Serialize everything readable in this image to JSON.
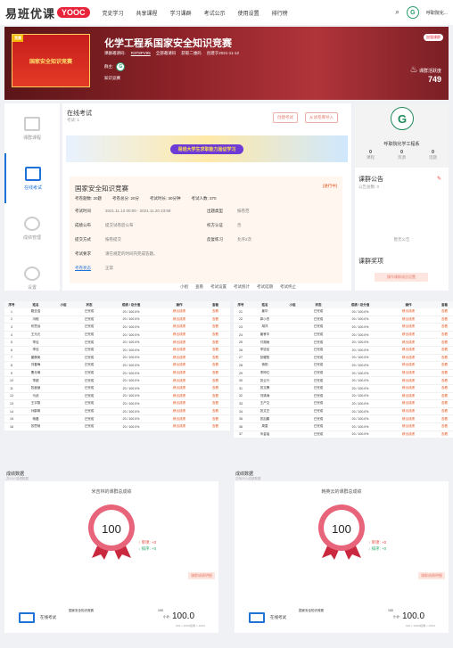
{
  "nav": {
    "logo": "易班优课",
    "badge": "YOOC",
    "links": [
      "党史学习",
      "共享课程",
      "学习课群",
      "考试公示",
      "使用设置",
      "排行榜"
    ],
    "user": "呼职院化..."
  },
  "banner": {
    "cover_text": "国家安全知识竞赛",
    "cover_tag": "竞赛",
    "title": "化学工程系国家安全知识竞赛",
    "code_label": "课群邀请码:",
    "code": "R3T8PV95",
    "meta2": "全部邀请码",
    "meta3": "获取二维码",
    "created": "创建于2021-11-12",
    "teacher_label": "群主:",
    "course_label": "知识竞赛",
    "badge": "加强课群",
    "activity_label": "课群活跃度",
    "activity": "749"
  },
  "side": [
    {
      "label": "课群课程"
    },
    {
      "label": "在线考试"
    },
    {
      "label": "成绩管理"
    },
    {
      "label": "设置"
    }
  ],
  "main": {
    "title": "在线考试",
    "count": "考试: 1",
    "btn_create": "创建考试",
    "btn_import": "从试卷库导入",
    "banner_text": "易班大学生求职能力验证学习",
    "exam": {
      "title": "国家安全知识竞赛",
      "status": "[进行中]",
      "q_count": "考卷题数: 20题",
      "total": "考卷总分: 20分",
      "duration": "考试时长: 30分钟",
      "people": "考试人数: 370",
      "rows": [
        [
          "考试时间",
          "2021.11.13 00:00 - 2021.11.20 23:59",
          "出题类型",
          "按卷范"
        ],
        [
          "成绩公布",
          "提交试卷后公布",
          "校方认证",
          "否"
        ],
        [
          "提交方式",
          "按卷提交",
          "反复练习",
          "允许2次"
        ],
        [
          "考试要求",
          "请在规定的时间内完成答题。",
          "",
          ""
        ],
        [
          "考卷状态",
          "正常",
          "",
          ""
        ]
      ]
    },
    "foot": [
      "小组",
      "查看",
      "考试设置",
      "考试统计",
      "考试延期",
      "考试终止"
    ]
  },
  "right": {
    "name": "呼职院化学工程系",
    "stats": [
      [
        "0",
        "课程"
      ],
      [
        "0",
        "资源"
      ],
      [
        "0",
        "话题"
      ]
    ],
    "notice_title": "课群公告",
    "notice_count": "公告总数: 0",
    "notice_none": "暂无公告",
    "reward_title": "课群奖项",
    "reward_btn": "操作课群成员设置"
  },
  "table_left": {
    "headers": [
      "序号",
      "姓名",
      "小组",
      "状态",
      "成绩 / 总分值",
      "操作",
      "查看"
    ],
    "rows": [
      [
        "1",
        "戴亚浩",
        "",
        "已完成",
        "20 / 100.0%",
        "移出成绩",
        "查看"
      ],
      [
        "2",
        "冯程",
        "",
        "已完成",
        "20 / 100.0%",
        "移出成绩",
        "查看"
      ],
      [
        "3",
        "布思远",
        "",
        "已完成",
        "20 / 100.0%",
        "移出成绩",
        "查看"
      ],
      [
        "4",
        "王元元",
        "",
        "已完成",
        "20 / 100.0%",
        "移出成绩",
        "查看"
      ],
      [
        "5",
        "李佳",
        "",
        "已完成",
        "20 / 100.0%",
        "移出成绩",
        "查看"
      ],
      [
        "6",
        "李佳",
        "",
        "已完成",
        "20 / 100.0%",
        "移出成绩",
        "查看"
      ],
      [
        "7",
        "董静美",
        "",
        "已完成",
        "20 / 100.0%",
        "移出成绩",
        "查看"
      ],
      [
        "8",
        "刘春梅",
        "",
        "已完成",
        "20 / 100.0%",
        "移出成绩",
        "查看"
      ],
      [
        "9",
        "曹月琳",
        "",
        "已完成",
        "20 / 100.0%",
        "移出成绩",
        "查看"
      ],
      [
        "10",
        "李超",
        "",
        "已完成",
        "20 / 100.0%",
        "移出成绩",
        "查看"
      ],
      [
        "11",
        "张鑫营",
        "",
        "已完成",
        "20 / 100.0%",
        "移出成绩",
        "查看"
      ],
      [
        "12",
        "马武",
        "",
        "已完成",
        "20 / 100.0%",
        "移出成绩",
        "查看"
      ],
      [
        "13",
        "王宇翔",
        "",
        "已完成",
        "20 / 100.0%",
        "移出成绩",
        "查看"
      ],
      [
        "14",
        "孙鹤明",
        "",
        "已完成",
        "20 / 100.0%",
        "移出成绩",
        "查看"
      ],
      [
        "15",
        "杨磊",
        "",
        "已完成",
        "20 / 100.0%",
        "移出成绩",
        "查看"
      ],
      [
        "16",
        "张思杨",
        "",
        "已完成",
        "20 / 100.0%",
        "移出成绩",
        "查看"
      ]
    ]
  },
  "table_right": {
    "headers": [
      "序号",
      "姓名",
      "小组",
      "状态",
      "成绩 / 总分值",
      "操作",
      "查看"
    ],
    "rows": [
      [
        "21",
        "姜华",
        "",
        "已完成",
        "20 / 100.0%",
        "移出成绩",
        "查看"
      ],
      [
        "22",
        "郭小杰",
        "",
        "已完成",
        "20 / 100.0%",
        "移出成绩",
        "查看"
      ],
      [
        "23",
        "胡洋",
        "",
        "已完成",
        "20 / 100.0%",
        "移出成绩",
        "查看"
      ],
      [
        "24",
        "姜睿丰",
        "",
        "已完成",
        "20 / 100.0%",
        "移出成绩",
        "查看"
      ],
      [
        "25",
        "付湘雨",
        "",
        "已完成",
        "20 / 100.0%",
        "移出成绩",
        "查看"
      ],
      [
        "26",
        "李钰佳",
        "",
        "已完成",
        "20 / 100.0%",
        "移出成绩",
        "查看"
      ],
      [
        "27",
        "张耀阳",
        "",
        "已完成",
        "20 / 100.0%",
        "移出成绩",
        "查看"
      ],
      [
        "28",
        "杨阳",
        "",
        "已完成",
        "20 / 100.0%",
        "移出成绩",
        "查看"
      ],
      [
        "29",
        "李婷红",
        "",
        "已完成",
        "20 / 100.0%",
        "移出成绩",
        "查看"
      ],
      [
        "30",
        "张云行",
        "",
        "已完成",
        "20 / 100.0%",
        "移出成绩",
        "查看"
      ],
      [
        "31",
        "张文腾",
        "",
        "已完成",
        "20 / 100.0%",
        "移出成绩",
        "查看"
      ],
      [
        "32",
        "刘清涛",
        "",
        "已完成",
        "20 / 100.0%",
        "移出成绩",
        "查看"
      ],
      [
        "33",
        "王产文",
        "",
        "已完成",
        "20 / 100.0%",
        "移出成绩",
        "查看"
      ],
      [
        "34",
        "张文艺",
        "",
        "已完成",
        "20 / 100.0%",
        "移出成绩",
        "查看"
      ],
      [
        "35",
        "张加鹏",
        "",
        "已完成",
        "20 / 100.0%",
        "移出成绩",
        "查看"
      ],
      [
        "36",
        "周童",
        "",
        "已完成",
        "20 / 100.0%",
        "移出成绩",
        "查看"
      ],
      [
        "37",
        "辛金瑶",
        "",
        "已完成",
        "20 / 100.0%",
        "移出成绩",
        "查看"
      ]
    ]
  },
  "sections": [
    {
      "title": "成绩数据",
      "sub": "共19人成绩数据"
    },
    {
      "title": "成绩数据",
      "sub": "共有20人成绩数据"
    }
  ],
  "charts": [
    {
      "title": "米吉林的课群总成绩",
      "score": "100",
      "up": "↑ 单项: +0",
      "down": "↓ 排序: +0",
      "btn": "课群成绩明细"
    },
    {
      "title": "韩英云的课群总成绩",
      "score": "100",
      "up": "↑ 单项: +0",
      "down": "↓ 排序: +0",
      "btn": "课群成绩明细"
    }
  ],
  "mini": [
    {
      "label": "在线考试",
      "name": "国家安全知识竞赛",
      "num": "100",
      "score_label": "小计:",
      "score": "100.0",
      "detail": "100 × 100%权重 = 100.0"
    },
    {
      "label": "在线考试",
      "name": "国家安全知识竞赛",
      "num": "100",
      "score_label": "小计:",
      "score": "100.0",
      "detail": "100 × 100%权重 = 100.0"
    }
  ]
}
